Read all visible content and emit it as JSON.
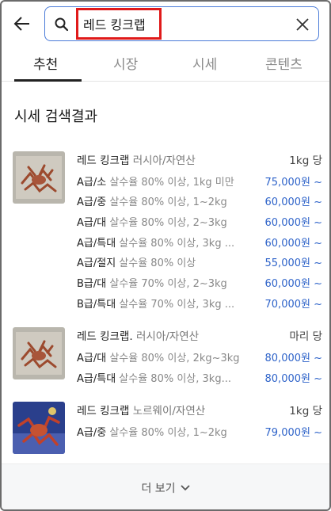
{
  "search": {
    "query": "레드 킹크랩"
  },
  "tabs": [
    {
      "label": "추천"
    },
    {
      "label": "시장"
    },
    {
      "label": "시세"
    },
    {
      "label": "콘텐츠"
    }
  ],
  "section_title": "시세 검색결과",
  "groups": [
    {
      "name": "레드 킹크랩",
      "origin": "러시아/자연산",
      "unit": "1kg 당",
      "rows": [
        {
          "grade": "A급/소",
          "desc": "살수율 80% 이상, 1kg 미만",
          "price": "75,000원 ~"
        },
        {
          "grade": "A급/중",
          "desc": "살수율 80% 이상, 1~2kg",
          "price": "60,000원 ~"
        },
        {
          "grade": "A급/대",
          "desc": "살수율 80% 이상, 2~3kg",
          "price": "60,000원 ~"
        },
        {
          "grade": "A급/특대",
          "desc": "살수율 80% 이상, 3kg ...",
          "price": "60,000원 ~"
        },
        {
          "grade": "A급/절지",
          "desc": "살수율 80% 이상",
          "price": "55,000원 ~"
        },
        {
          "grade": "B급/대",
          "desc": "살수율 70% 이상, 2~3kg",
          "price": "60,000원 ~"
        },
        {
          "grade": "B급/특대",
          "desc": "살수율 70% 이상, 3kg ...",
          "price": "70,000원 ~"
        }
      ]
    },
    {
      "name": "레드 킹크랩.",
      "origin": "러시아/자연산",
      "unit": "마리 당",
      "rows": [
        {
          "grade": "A급/대",
          "desc": "살수율 80% 이상, 2kg~3kg",
          "price": "80,000원 ~"
        },
        {
          "grade": "A급/특대",
          "desc": "살수율 80% 이상, 3kg...",
          "price": "80,000원 ~"
        }
      ]
    },
    {
      "name": "레드 킹크랩",
      "origin": "노르웨이/자연산",
      "unit": "1kg 당",
      "rows": [
        {
          "grade": "A급/중",
          "desc": "살수율 80% 이상, 1~2kg",
          "price": "79,000원 ~"
        }
      ]
    }
  ],
  "more_label": "더 보기",
  "colors": {
    "price": "#2e63c9",
    "highlight": "#e01a1a",
    "search_border": "#4a7bd8"
  }
}
